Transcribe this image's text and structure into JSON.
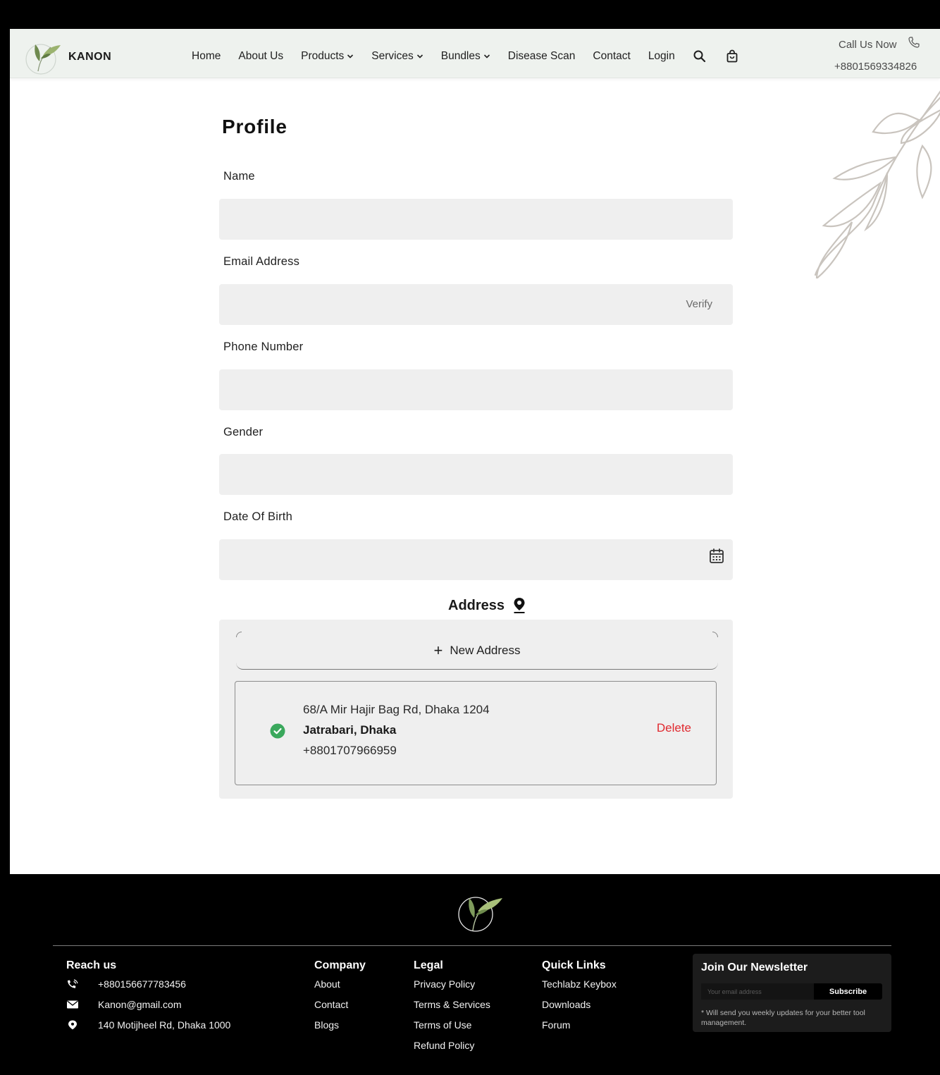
{
  "header": {
    "brand": "KANON",
    "nav": [
      {
        "label": "Home",
        "dropdown": false
      },
      {
        "label": "About Us",
        "dropdown": false
      },
      {
        "label": "Products",
        "dropdown": true
      },
      {
        "label": "Services",
        "dropdown": true
      },
      {
        "label": "Bundles",
        "dropdown": true
      },
      {
        "label": "Disease Scan",
        "dropdown": false
      },
      {
        "label": "Contact",
        "dropdown": false
      },
      {
        "label": "Login",
        "dropdown": false
      }
    ],
    "icons": [
      "search-icon",
      "shopping-bag-icon"
    ],
    "call_label": "Call Us Now",
    "call_phone": "+8801569334826"
  },
  "profile": {
    "title": "Profile",
    "fields": {
      "name_label": "Name",
      "name_value": "",
      "email_label": "Email Address",
      "email_value": "",
      "verify_label": "Verify",
      "phone_label": "Phone Number",
      "phone_value": "",
      "gender_label": "Gender",
      "gender_value": "",
      "dob_label": "Date Of Birth",
      "dob_value": ""
    },
    "address": {
      "title": "Address",
      "new_address_label": "New Address",
      "items": [
        {
          "line1": "68/A Mir Hajir Bag Rd, Dhaka 1204",
          "line2": "Jatrabari, Dhaka",
          "line3": "+8801707966959",
          "selected": true,
          "delete_label": "Delete"
        }
      ]
    }
  },
  "footer": {
    "reach": {
      "heading": "Reach us",
      "phone": "+880156677783456",
      "email": "Kanon@gmail.com",
      "address": "140 Motijheel Rd, Dhaka 1000"
    },
    "company": {
      "heading": "Company",
      "links": [
        "About",
        "Contact",
        "Blogs"
      ]
    },
    "legal": {
      "heading": "Legal",
      "links": [
        "Privacy Policy",
        "Terms & Services",
        "Terms of Use",
        "Refund Policy"
      ]
    },
    "quick": {
      "heading": "Quick Links",
      "links": [
        "Techlabz Keybox",
        "Downloads",
        "Forum"
      ]
    },
    "newsletter": {
      "heading": "Join Our Newsletter",
      "placeholder": "Your email address",
      "button": "Subscribe",
      "note": "* Will send you weekly updates for your better tool management."
    }
  },
  "colors": {
    "header_bg": "#eef2ee",
    "field_bg": "#efefef",
    "delete_red": "#e0292f",
    "check_green": "#3aa85c",
    "footer_bg": "#000000"
  }
}
